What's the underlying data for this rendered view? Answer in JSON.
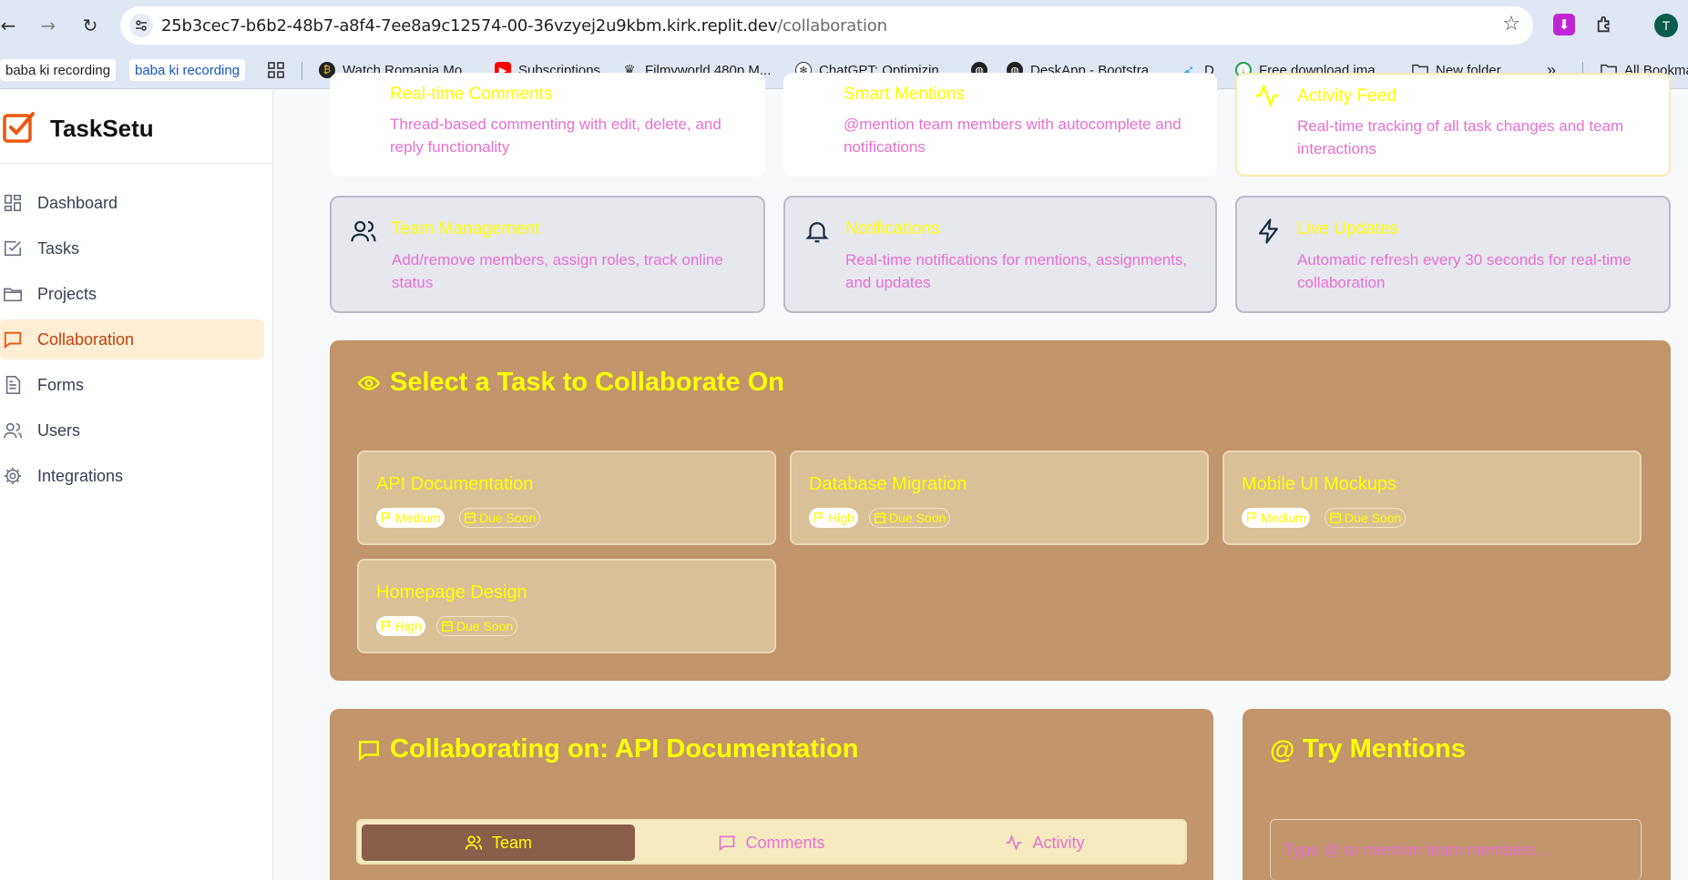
{
  "browser": {
    "url_host": "25b3cec7-b6b2-48b7-a8f4-7ee8a9c12574-00-36vzyej2u9kbm.kirk.replit.dev",
    "url_path": "/collaboration",
    "profile_initial": "T",
    "bookmarks": [
      {
        "label": "baba ki recording",
        "icon": "none"
      },
      {
        "label": "baba ki recording",
        "icon": "none"
      },
      {
        "label": "Watch Romania Mo...",
        "icon": "coin-icon"
      },
      {
        "label": "Subscriptions",
        "icon": "youtube-icon"
      },
      {
        "label": "Filmyworld 480p M...",
        "icon": "crown-icon"
      },
      {
        "label": "ChatGPT: Optimizin...",
        "icon": "chatgpt-icon"
      },
      {
        "label": "",
        "icon": "globe-icon"
      },
      {
        "label": "DeskApp - Bootstra...",
        "icon": "globe-icon"
      },
      {
        "label": "D",
        "icon": "bird-icon"
      },
      {
        "label": "Free download ima...",
        "icon": "download-icon"
      },
      {
        "label": "New folder",
        "icon": "folder-icon"
      },
      {
        "label": "All Bookmarks",
        "icon": "folder-icon"
      }
    ]
  },
  "app": {
    "name": "TaskSetu",
    "accent": "#ea580c"
  },
  "sidebar": {
    "items": [
      {
        "label": "Dashboard",
        "icon": "dashboard-icon",
        "active": false
      },
      {
        "label": "Tasks",
        "icon": "tasks-icon",
        "active": false
      },
      {
        "label": "Projects",
        "icon": "folder-icon",
        "active": false
      },
      {
        "label": "Collaboration",
        "icon": "message-icon",
        "active": true
      },
      {
        "label": "Forms",
        "icon": "form-icon",
        "active": false
      },
      {
        "label": "Users",
        "icon": "users-icon",
        "active": false
      },
      {
        "label": "Integrations",
        "icon": "gear-icon",
        "active": false
      }
    ]
  },
  "features": [
    {
      "title": "Real-time Comments",
      "desc": "Thread-based commenting with edit, delete, and reply functionality",
      "icon": "message-icon"
    },
    {
      "title": "Smart Mentions",
      "desc": "@mention team members with autocomplete and notifications",
      "icon": "at-icon"
    },
    {
      "title": "Activity Feed",
      "desc": "Real-time tracking of all task changes and team interactions",
      "icon": "activity-icon"
    },
    {
      "title": "Team Management",
      "desc": "Add/remove members, assign roles, track online status",
      "icon": "users-icon"
    },
    {
      "title": "Notifications",
      "desc": "Real-time notifications for mentions, assignments, and updates",
      "icon": "bell-icon"
    },
    {
      "title": "Live Updates",
      "desc": "Automatic refresh every 30 seconds for real-time collaboration",
      "icon": "lightning-icon"
    }
  ],
  "select_panel": {
    "title": "Select a Task to Collaborate On",
    "tasks": [
      {
        "title": "API Documentation",
        "priority": "Medium",
        "due": "Due Soon"
      },
      {
        "title": "Database Migration",
        "priority": "High",
        "due": "Due Soon"
      },
      {
        "title": "Mobile UI Mockups",
        "priority": "Medium",
        "due": "Due Soon"
      },
      {
        "title": "Homepage Design",
        "priority": "High",
        "due": "Due Soon"
      }
    ]
  },
  "collab_panel": {
    "title": "Collaborating on: API Documentation",
    "tabs": [
      {
        "label": "Team",
        "icon": "users-icon",
        "active": true
      },
      {
        "label": "Comments",
        "icon": "message-icon",
        "active": false
      },
      {
        "label": "Activity",
        "icon": "activity-icon",
        "active": false
      }
    ]
  },
  "mentions_panel": {
    "title": "Try Mentions",
    "placeholder": "Type @ to mention team members..."
  }
}
